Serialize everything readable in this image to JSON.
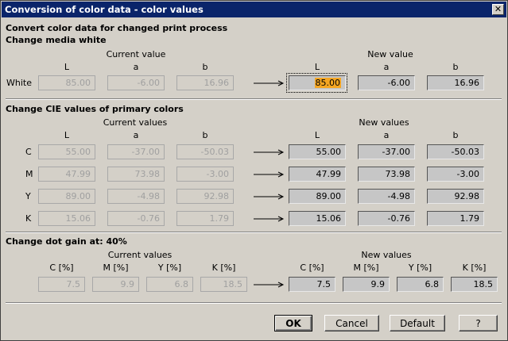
{
  "window": {
    "title": "Conversion of color data - color values",
    "close_glyph": "✕"
  },
  "intro": {
    "heading": "Convert color data for changed print process",
    "subheading": "Change media white"
  },
  "media_white": {
    "current_label": "Current value",
    "new_label": "New value",
    "col_headers": [
      "L",
      "a",
      "b"
    ],
    "row_label": "White",
    "current": [
      "85.00",
      "-6.00",
      "16.96"
    ],
    "new": [
      "85.00",
      "-6.00",
      "16.96"
    ]
  },
  "primaries": {
    "heading": "Change CIE values of primary colors",
    "current_label": "Current values",
    "new_label": "New values",
    "col_headers": [
      "L",
      "a",
      "b"
    ],
    "rows": [
      {
        "label": "C",
        "current": [
          "55.00",
          "-37.00",
          "-50.03"
        ],
        "new": [
          "55.00",
          "-37.00",
          "-50.03"
        ]
      },
      {
        "label": "M",
        "current": [
          "47.99",
          "73.98",
          "-3.00"
        ],
        "new": [
          "47.99",
          "73.98",
          "-3.00"
        ]
      },
      {
        "label": "Y",
        "current": [
          "89.00",
          "-4.98",
          "92.98"
        ],
        "new": [
          "89.00",
          "-4.98",
          "92.98"
        ]
      },
      {
        "label": "K",
        "current": [
          "15.06",
          "-0.76",
          "1.79"
        ],
        "new": [
          "15.06",
          "-0.76",
          "1.79"
        ]
      }
    ]
  },
  "dot_gain": {
    "heading": "Change dot gain at: 40%",
    "current_label": "Current values",
    "new_label": "New values",
    "col_headers": [
      "C [%]",
      "M [%]",
      "Y [%]",
      "K [%]"
    ],
    "current": [
      "7.5",
      "9.9",
      "6.8",
      "18.5"
    ],
    "new": [
      "7.5",
      "9.9",
      "6.8",
      "18.5"
    ]
  },
  "buttons": {
    "ok": "OK",
    "cancel": "Cancel",
    "default": "Default",
    "help": "?"
  },
  "colors": {
    "titlebar": "#0a246a",
    "focus_highlight": "#f5a623"
  }
}
